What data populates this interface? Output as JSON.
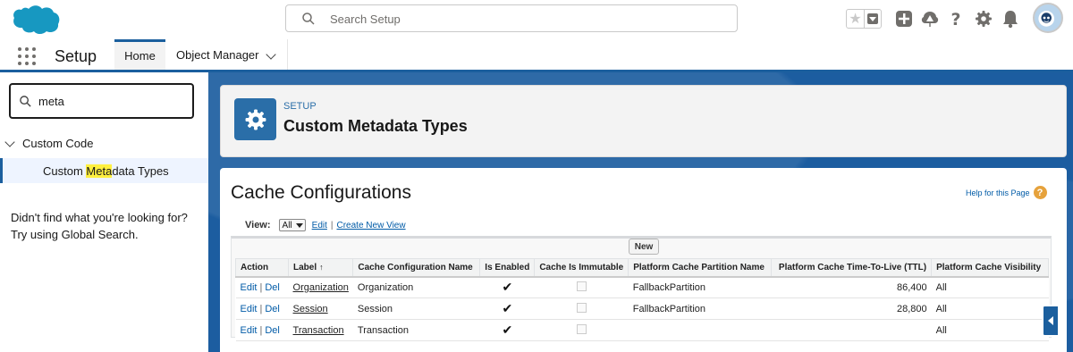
{
  "header": {
    "search_placeholder": "Search Setup",
    "icons": [
      "salesforce-cloud-logo",
      "favorites-star-icon",
      "favorites-dropdown-icon",
      "global-actions-plus-icon",
      "trailhead-icon",
      "help-icon",
      "setup-gear-icon",
      "notifications-bell-icon",
      "user-avatar"
    ]
  },
  "context_bar": {
    "app_name": "Setup",
    "tabs": [
      {
        "label": "Home",
        "active": true
      },
      {
        "label": "Object Manager",
        "active": false
      }
    ]
  },
  "sidebar": {
    "quick_find_value": "meta",
    "tree": {
      "parent": "Custom Code",
      "child": {
        "before": "Custom ",
        "highlight": "Meta",
        "after": "data Types"
      }
    },
    "not_found_line1": "Didn't find what you're looking for?",
    "not_found_line2": "Try using Global Search."
  },
  "page_header": {
    "eyebrow": "SETUP",
    "title": "Custom Metadata Types"
  },
  "content": {
    "title": "Cache Configurations",
    "help_link": "Help for this Page",
    "view_label": "View:",
    "view_selected": "All",
    "edit_link": "Edit",
    "separator": "|",
    "create_view_link": "Create New View",
    "new_button": "New",
    "columns": [
      "Action",
      "Label",
      "Cache Configuration Name",
      "Is Enabled",
      "Cache Is Immutable",
      "Platform Cache Partition Name",
      "Platform Cache Time-To-Live (TTL)",
      "Platform Cache Visibility"
    ],
    "sort_indicator": "↑",
    "rows": [
      {
        "edit": "Edit",
        "del": "Del",
        "label": "Organization",
        "name": "Organization",
        "enabled": "✔",
        "partition": "FallbackPartition",
        "ttl": "86,400",
        "visibility": "All"
      },
      {
        "edit": "Edit",
        "del": "Del",
        "label": "Session",
        "name": "Session",
        "enabled": "✔",
        "partition": "FallbackPartition",
        "ttl": "28,800",
        "visibility": "All"
      },
      {
        "edit": "Edit",
        "del": "Del",
        "label": "Transaction",
        "name": "Transaction",
        "enabled": "✔",
        "partition": "",
        "ttl": "",
        "visibility": "All"
      }
    ]
  },
  "colors": {
    "brand_blue": "#1b5f9e",
    "link_blue": "#015ba7",
    "highlight_yellow": "#fff03f",
    "help_orange": "#e6a23c"
  }
}
